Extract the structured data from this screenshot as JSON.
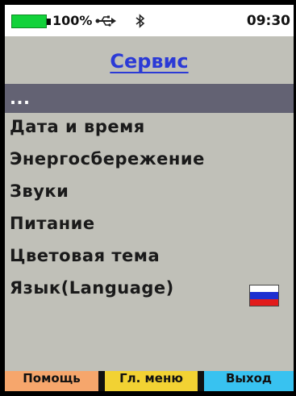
{
  "status": {
    "battery_text": "100%",
    "time": "09:30",
    "icons": [
      "battery-icon",
      "usb-icon",
      "bluetooth-icon"
    ],
    "battery_level": 1.0,
    "battery_color": "#12d23a"
  },
  "screen": {
    "title": "Сервис"
  },
  "menu": {
    "items": [
      {
        "label": "...",
        "selected": true
      },
      {
        "label": "Дата и время"
      },
      {
        "label": "Энергосбережение"
      },
      {
        "label": "Звуки"
      },
      {
        "label": "Питание"
      },
      {
        "label": "Цветовая тема"
      },
      {
        "label": "Язык(Language)",
        "icon": "russian-flag-icon"
      }
    ]
  },
  "softkeys": {
    "help": "Помощь",
    "main_menu": "Гл. меню",
    "exit": "Выход"
  },
  "colors": {
    "panel_bg": "#c0c0b8",
    "selected_bg": "#636273",
    "title": "#2b3ad6",
    "help_key": "#f6a66c",
    "menu_key": "#f2d233",
    "exit_key": "#38c2f0"
  }
}
